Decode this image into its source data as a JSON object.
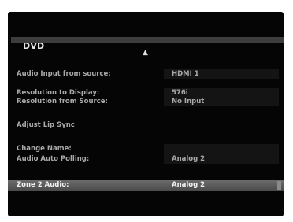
{
  "menu": {
    "section_title": "DVD",
    "scroll_up_icon": "▲",
    "rows": [
      {
        "label": "Audio Input from source:",
        "value": "HDMI 1"
      },
      {
        "label": "Resolution to Display:",
        "value": "576i"
      },
      {
        "label": "Resolution from Source:",
        "value": "No Input"
      },
      {
        "label": "Adjust Lip Sync",
        "value": ""
      },
      {
        "label": "Change Name:",
        "value": ""
      },
      {
        "label": "Audio Auto Polling:",
        "value": "Analog 2"
      },
      {
        "label": "Zone 2 Audio:",
        "value": "Analog 2"
      }
    ]
  }
}
